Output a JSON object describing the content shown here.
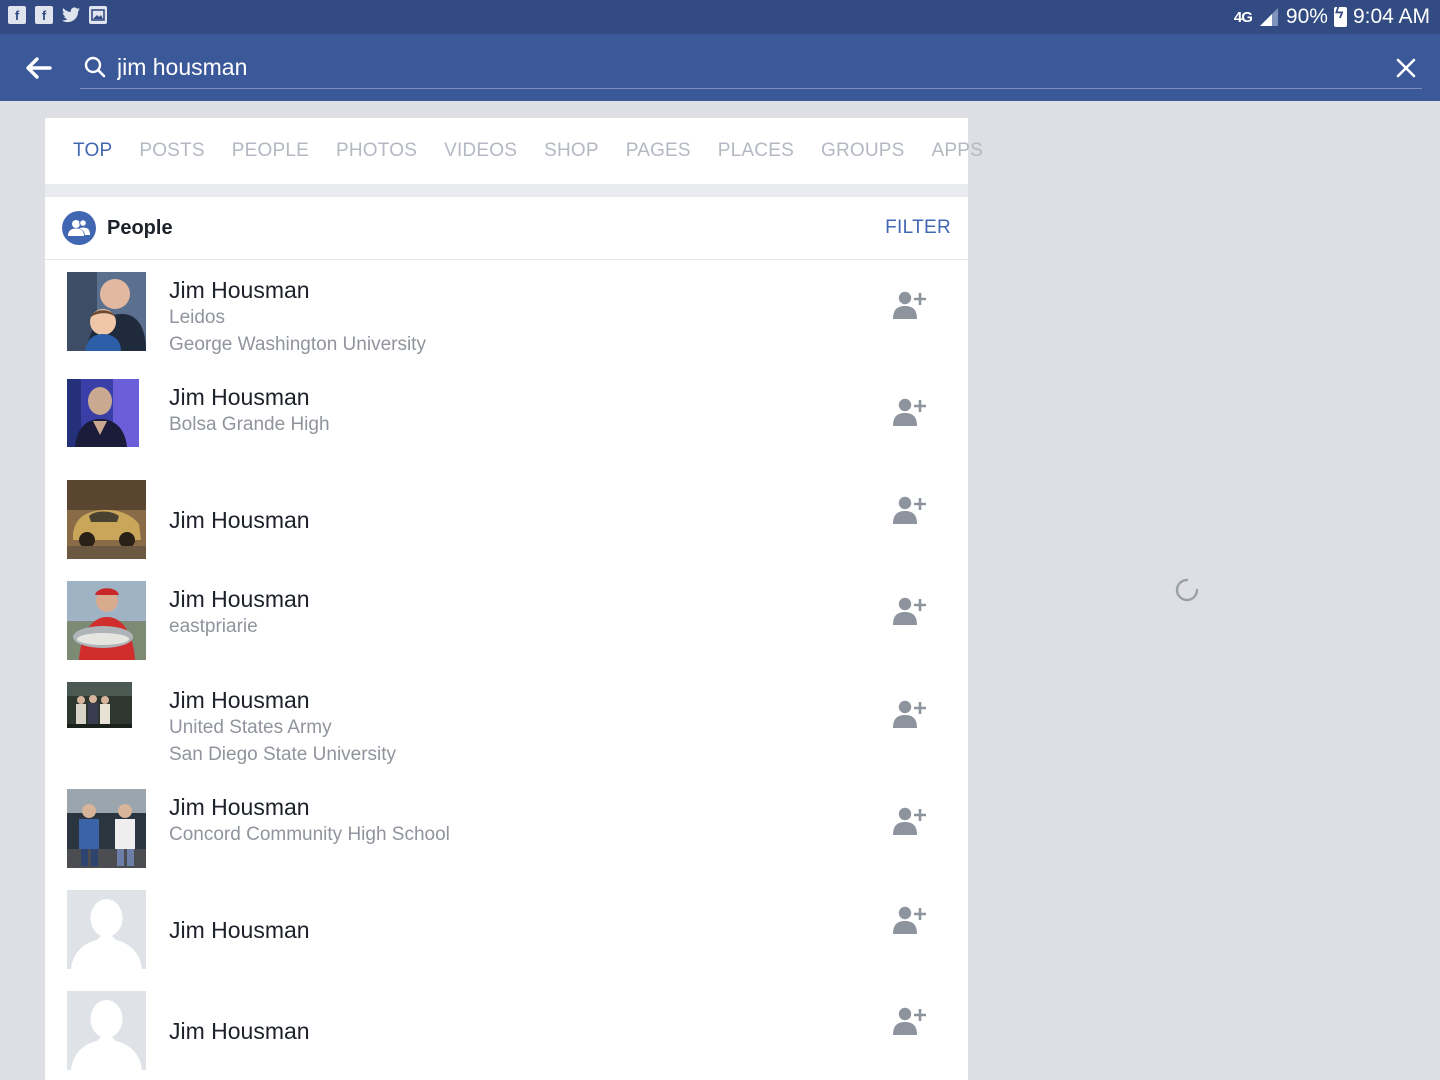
{
  "status_bar": {
    "net": "4G",
    "battery": "90%",
    "time": "9:04 AM",
    "icons": [
      "facebook-icon",
      "facebook-icon",
      "twitter-icon",
      "gallery-icon"
    ]
  },
  "search": {
    "query": "jim housman",
    "icons": {
      "back": "back-arrow-icon",
      "search": "search-icon",
      "clear": "close-icon"
    }
  },
  "tabs": [
    "TOP",
    "POSTS",
    "PEOPLE",
    "PHOTOS",
    "VIDEOS",
    "SHOP",
    "PAGES",
    "PLACES",
    "GROUPS",
    "APPS"
  ],
  "active_tab": "TOP",
  "section": {
    "title": "People",
    "filter_label": "FILTER",
    "icon": "people-icon"
  },
  "results": [
    {
      "name": "Jim Housman",
      "details": [
        "Leidos",
        "George Washington University"
      ],
      "photo": "man-with-child"
    },
    {
      "name": "Jim Housman",
      "details": [
        "Bolsa Grande High"
      ],
      "photo": "man-purple"
    },
    {
      "name": "Jim Housman",
      "details": [],
      "photo": "old-car"
    },
    {
      "name": "Jim Housman",
      "details": [
        "eastpriarie"
      ],
      "photo": "man-with-fish"
    },
    {
      "name": "Jim Housman",
      "details": [
        "United States Army",
        "San Diego State University"
      ],
      "photo": "group-photo"
    },
    {
      "name": "Jim Housman",
      "details": [
        "Concord Community High School"
      ],
      "photo": "two-men"
    },
    {
      "name": "Jim Housman",
      "details": [],
      "photo": "default-silhouette"
    },
    {
      "name": "Jim Housman",
      "details": [],
      "photo": "default-silhouette"
    }
  ],
  "colors": {
    "header": "#3b5998",
    "status_bar": "#324b82",
    "accent": "#4267b2",
    "background": "#dddfe4"
  }
}
